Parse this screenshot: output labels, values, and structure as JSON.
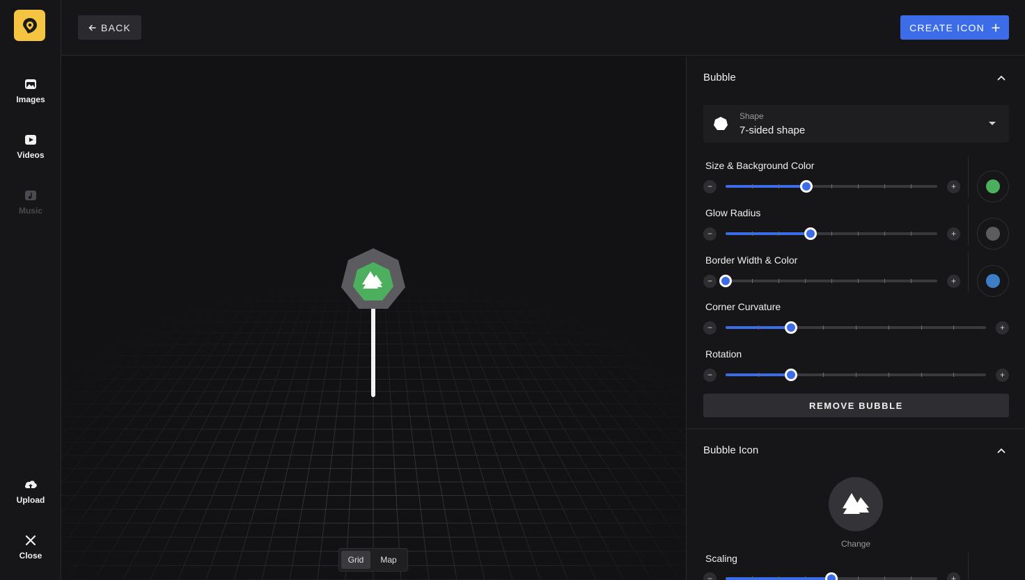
{
  "rail": {
    "images": "Images",
    "videos": "Videos",
    "music": "Music",
    "upload": "Upload",
    "close": "Close"
  },
  "topbar": {
    "back": "BACK",
    "create": "CREATE ICON"
  },
  "canvas": {
    "toggle_grid": "Grid",
    "toggle_map": "Map",
    "active_view": "Grid"
  },
  "bubble": {
    "title": "Bubble",
    "shape_label": "Shape",
    "shape_value": "7-sided shape",
    "controls": [
      {
        "label": "Size & Background Color",
        "value": 0.38,
        "color": "#4caf5e"
      },
      {
        "label": "Glow Radius",
        "value": 0.4,
        "color": "#5c5c60"
      },
      {
        "label": "Border Width & Color",
        "value": 0.0,
        "color": "#3e7ec4"
      },
      {
        "label": "Corner Curvature",
        "value": 0.25
      },
      {
        "label": "Rotation",
        "value": 0.25
      }
    ],
    "remove": "REMOVE BUBBLE"
  },
  "bubble_icon": {
    "title": "Bubble Icon",
    "icon": "trees-icon",
    "change": "Change",
    "scaling_label": "Scaling",
    "scaling_value": 0.5
  },
  "colors": {
    "accent": "#3d6ce8",
    "logo": "#f5c542",
    "bubble_bg": "#4caf5e"
  }
}
